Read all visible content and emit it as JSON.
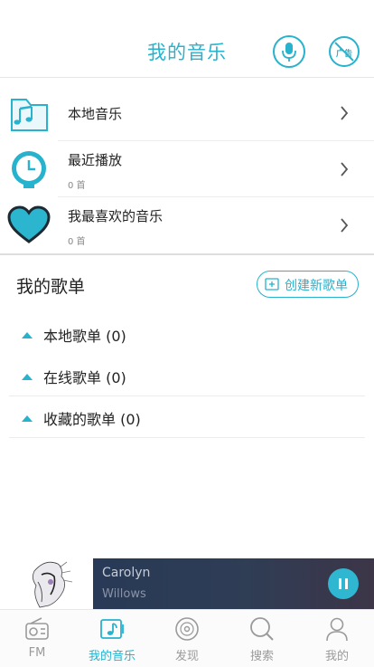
{
  "header": {
    "title": "我的音乐",
    "ad_label": "广告"
  },
  "menu": {
    "items": [
      {
        "label": "本地音乐",
        "sub": ""
      },
      {
        "label": "最近播放",
        "sub": "0 首"
      },
      {
        "label": "我最喜欢的音乐",
        "sub": "0 首"
      }
    ]
  },
  "playlists": {
    "title": "我的歌单",
    "create_label": "创建新歌单",
    "groups": [
      {
        "label": "本地歌单 (0)"
      },
      {
        "label": "在线歌单 (0)"
      },
      {
        "label": "收藏的歌单 (0)"
      }
    ]
  },
  "player": {
    "song": "Carolyn",
    "artist": "Willows",
    "state": "playing"
  },
  "tabbar": {
    "tabs": [
      {
        "label": "FM",
        "icon": "radio-icon"
      },
      {
        "label": "我的音乐",
        "icon": "music-note-icon"
      },
      {
        "label": "发现",
        "icon": "disc-icon"
      },
      {
        "label": "搜索",
        "icon": "search-icon"
      },
      {
        "label": "我的",
        "icon": "user-icon"
      }
    ],
    "active_index": 1
  },
  "colors": {
    "accent": "#27b2cd",
    "player_bg": "#2f3d55",
    "text": "#222222",
    "muted": "#9a9a9a"
  }
}
